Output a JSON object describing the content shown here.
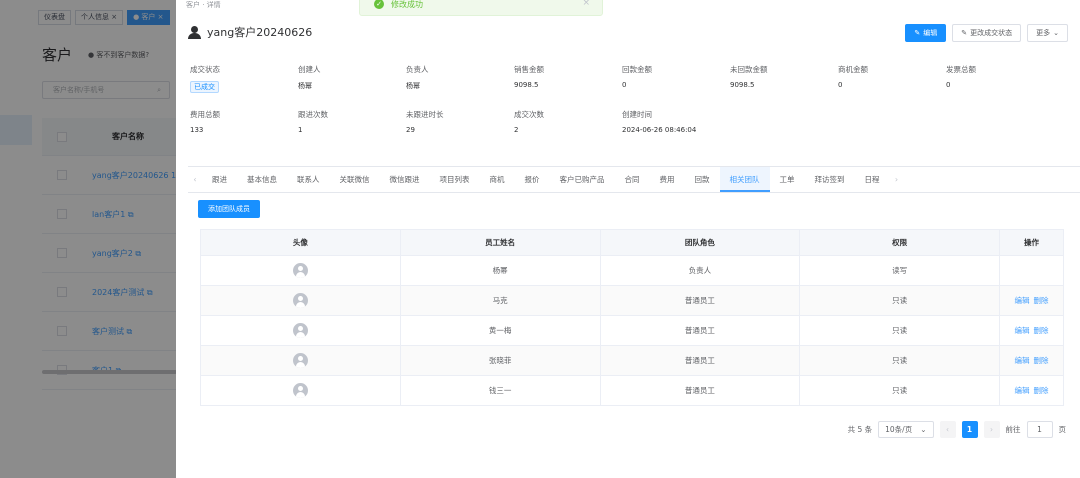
{
  "background": {
    "tabs": [
      {
        "label": "仪表盘"
      },
      {
        "label": "个人信息 ×"
      },
      {
        "label": "● 客户 ×"
      }
    ],
    "title": "客户",
    "hint": "● 客不到客户数据?",
    "search_placeholder": "客户名称/手机号",
    "table_header": "客户名称",
    "rows": [
      "yang客户20240626 1",
      "lan客户1 ⧉",
      "yang客户2 ⧉",
      "2024客户测试 ⧉",
      "客户测试 ⧉",
      "客户1 ⧉"
    ]
  },
  "toast": {
    "text": "修改成功",
    "close": "×"
  },
  "drawer": {
    "top_cut_text": "客户 · 详情",
    "customer_name": "yang客户20240626",
    "actions": {
      "edit": "编辑",
      "change_status": "更改成交状态",
      "more": "更多"
    },
    "info": [
      [
        {
          "label": "成交状态",
          "value": "已成交",
          "tag": true
        },
        {
          "label": "创建人",
          "value": "杨幂"
        },
        {
          "label": "负责人",
          "value": "杨幂"
        },
        {
          "label": "销售金额",
          "value": "9098.5"
        },
        {
          "label": "回款金额",
          "value": "0"
        },
        {
          "label": "未回款金额",
          "value": "9098.5"
        },
        {
          "label": "商机金额",
          "value": "0"
        },
        {
          "label": "发票总额",
          "value": "0"
        }
      ],
      [
        {
          "label": "费用总额",
          "value": "133"
        },
        {
          "label": "跟进次数",
          "value": "1"
        },
        {
          "label": "未跟进时长",
          "value": "29"
        },
        {
          "label": "成交次数",
          "value": "2"
        },
        {
          "label": "创建时间",
          "value": "2024-06-26 08:46:04"
        }
      ]
    ],
    "tabs": [
      "跟进",
      "基本信息",
      "联系人",
      "关联微信",
      "微信跟进",
      "项目列表",
      "商机",
      "报价",
      "客户已购产品",
      "合同",
      "费用",
      "回款",
      "相关团队",
      "工单",
      "拜访签到",
      "日程"
    ],
    "active_tab": "相关团队",
    "add_member_label": "添加团队成员",
    "table": {
      "headers": [
        "头像",
        "员工姓名",
        "团队角色",
        "权限",
        "操作"
      ],
      "rows": [
        {
          "name": "杨幂",
          "role": "负责人",
          "permission": "读写",
          "ops": false
        },
        {
          "name": "马克",
          "role": "普通员工",
          "permission": "只读",
          "ops": true
        },
        {
          "name": "黄一梅",
          "role": "普通员工",
          "permission": "只读",
          "ops": true
        },
        {
          "name": "张晓菲",
          "role": "普通员工",
          "permission": "只读",
          "ops": true
        },
        {
          "name": "钱三一",
          "role": "普通员工",
          "permission": "只读",
          "ops": true
        }
      ],
      "op_edit": "编辑",
      "op_delete": "删除"
    },
    "pagination": {
      "total": "共 5 条",
      "page_size": "10条/页",
      "current_page": "1",
      "goto_prefix": "前往",
      "goto_value": "1",
      "goto_suffix": "页"
    }
  }
}
